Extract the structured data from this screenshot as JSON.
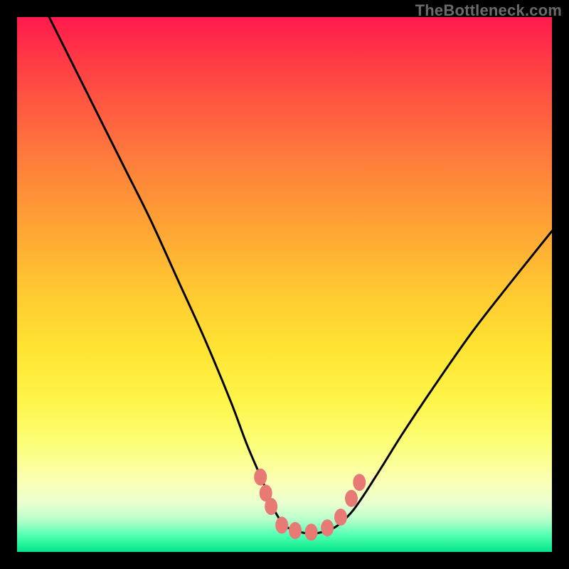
{
  "watermark": "TheBottleneck.com",
  "colors": {
    "background": "#000000",
    "curve": "#000000",
    "marker": "#e77a74",
    "gradient_top": "#ff1a4d",
    "gradient_bottom": "#00e588"
  },
  "chart_data": {
    "type": "line",
    "title": "",
    "xlabel": "",
    "ylabel": "",
    "xlim": [
      0,
      100
    ],
    "ylim": [
      0,
      100
    ],
    "series": [
      {
        "name": "bottleneck-curve",
        "x": [
          6,
          10,
          15,
          20,
          25,
          30,
          35,
          40,
          43,
          46,
          48,
          50,
          52,
          54,
          56,
          58,
          60,
          63,
          67,
          72,
          78,
          85,
          92,
          100
        ],
        "y": [
          100,
          92,
          82,
          72,
          62,
          51,
          40,
          28,
          20,
          13,
          8,
          5,
          4,
          3.5,
          3.5,
          4,
          5,
          8,
          14,
          22,
          31,
          41,
          50,
          60
        ]
      }
    ],
    "markers": {
      "name": "optimal-markers",
      "points": [
        {
          "x": 45.5,
          "y": 14
        },
        {
          "x": 46.5,
          "y": 11
        },
        {
          "x": 47.5,
          "y": 8.5
        },
        {
          "x": 49.5,
          "y": 5
        },
        {
          "x": 52,
          "y": 4
        },
        {
          "x": 55,
          "y": 3.7
        },
        {
          "x": 58,
          "y": 4.5
        },
        {
          "x": 60.5,
          "y": 6.5
        },
        {
          "x": 62.5,
          "y": 10
        },
        {
          "x": 64,
          "y": 13
        }
      ]
    }
  }
}
